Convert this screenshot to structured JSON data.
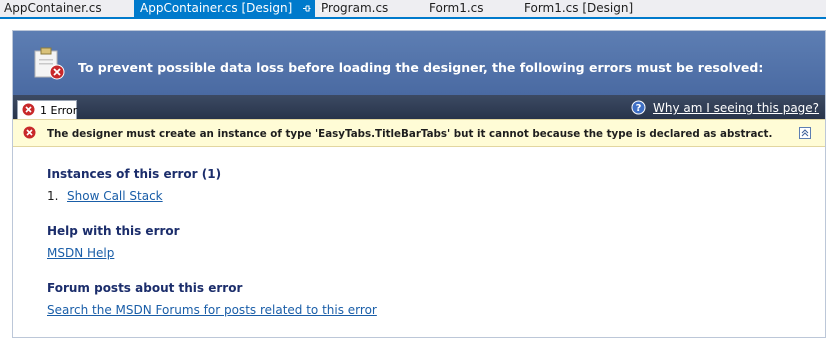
{
  "tabs": [
    {
      "label": "AppContainer.cs",
      "active": false
    },
    {
      "label": "AppContainer.cs [Design]",
      "active": true
    },
    {
      "label": "Program.cs",
      "active": false
    },
    {
      "label": "Form1.cs",
      "active": false
    },
    {
      "label": "Form1.cs [Design]",
      "active": false
    }
  ],
  "tab_icons": {
    "pin": "pin-icon",
    "close": "close-icon"
  },
  "banner": {
    "title": "To prevent possible data loss before loading the designer, the following errors must be resolved:",
    "icon": "clipboard-error-icon"
  },
  "error_tab": {
    "label": "1 Error",
    "icon": "error-icon"
  },
  "help": {
    "link": "Why am I seeing this page?",
    "icon": "help-icon"
  },
  "error": {
    "message": "The designer must create an instance of type 'EasyTabs.TitleBarTabs' but it cannot because the type is declared as abstract.",
    "icon": "error-icon",
    "collapse_icon": "collapse-icon"
  },
  "instances": {
    "heading": "Instances of this error (1)",
    "items": [
      {
        "number": "1.",
        "link": "Show Call Stack"
      }
    ]
  },
  "help_section": {
    "heading": "Help with this error",
    "link": "MSDN Help"
  },
  "forum_section": {
    "heading": "Forum posts about this error",
    "link": "Search the MSDN Forums for posts related to this error"
  },
  "colors": {
    "accent": "#007acc",
    "banner": "#5d7eb3",
    "error_bar": "#fffcd6",
    "error_red": "#c8282a",
    "link": "#1a5ea8"
  }
}
